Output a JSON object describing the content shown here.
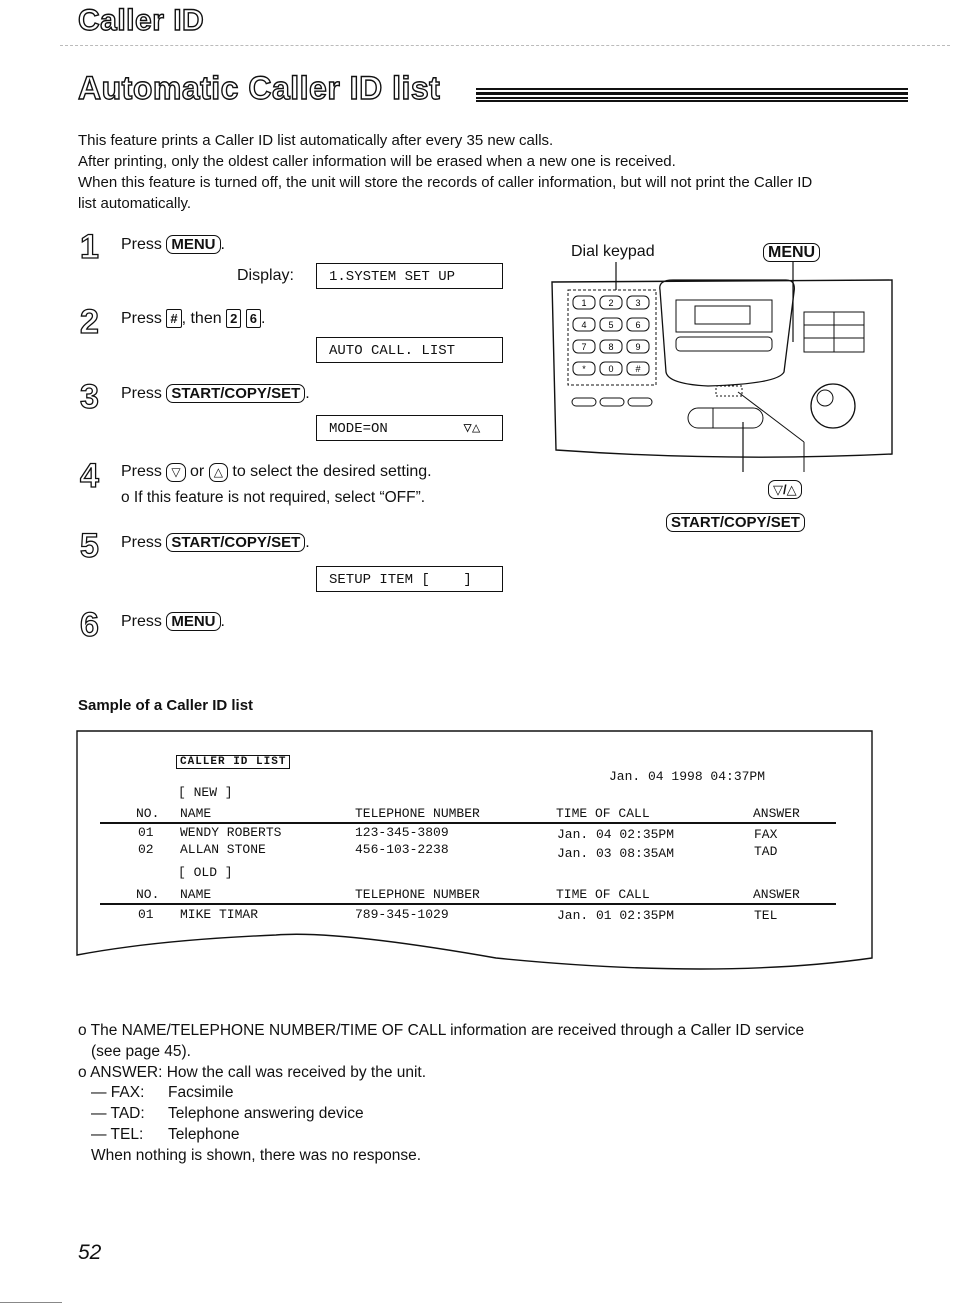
{
  "header": {
    "section_title": "Caller ID",
    "page_heading": "Automatic Caller ID list"
  },
  "intro": [
    "This feature prints a Caller ID list automatically after every 35 new calls.",
    "After printing, only the oldest caller information will be erased when a new one is received.",
    "When this feature is turned off, the unit will store the records of caller information, but will not print the Caller ID",
    "list automatically."
  ],
  "steps": [
    {
      "num": "1",
      "prefix": "Press ",
      "key1": "MENU",
      "suffix": ".",
      "display_label": "Display:",
      "display": "1.SYSTEM SET UP"
    },
    {
      "num": "2",
      "prefix": "Press ",
      "key1": "#",
      "mid": ", then ",
      "key2": "2",
      "key3": "6",
      "suffix": ".",
      "display": "AUTO CALL. LIST"
    },
    {
      "num": "3",
      "prefix": "Press ",
      "key1": "START/COPY/SET",
      "suffix": ".",
      "display": "MODE=ON         ▽△"
    },
    {
      "num": "4",
      "prefix": "Press ",
      "key1": "▽",
      "mid": " or ",
      "key2": "△",
      "suffix": " to select the desired setting.",
      "note": "o If this feature is not required, select “OFF”."
    },
    {
      "num": "5",
      "prefix": "Press ",
      "key1": "START/COPY/SET",
      "suffix": ".",
      "display": "SETUP ITEM [    ]"
    },
    {
      "num": "6",
      "prefix": "Press ",
      "key1": "MENU",
      "suffix": "."
    }
  ],
  "diagram": {
    "label_keypad": "Dial keypad",
    "label_menu": "MENU",
    "label_arrows": "▽/△",
    "label_start": "START/COPY/SET",
    "keypad_keys": [
      "1",
      "2",
      "3",
      "4",
      "5",
      "6",
      "7",
      "8",
      "9",
      "*",
      "0",
      "#"
    ]
  },
  "sample": {
    "title": "Sample of a Caller ID list",
    "list_title": "CALLER ID LIST",
    "printed_at": "Jan. 04 1998 04:37PM",
    "columns": [
      "NO.",
      "NAME",
      "TELEPHONE NUMBER",
      "TIME OF CALL",
      "ANSWER"
    ],
    "new_label": "[ NEW ]",
    "old_label": "[ OLD ]",
    "new_rows": [
      [
        "01",
        "WENDY ROBERTS",
        "123-345-3809",
        "Jan. 04 02:35PM",
        "FAX"
      ],
      [
        "02",
        "ALLAN STONE",
        "456-103-2238",
        "Jan. 03 08:35AM",
        "TAD"
      ]
    ],
    "old_rows": [
      [
        "01",
        "MIKE TIMAR",
        "789-345-1029",
        "Jan. 01 02:35PM",
        "TEL"
      ]
    ]
  },
  "notes": {
    "line1": "o The NAME/TELEPHONE NUMBER/TIME OF CALL information are received through a Caller ID service",
    "line1b": "(see page 45).",
    "line2": "o ANSWER:  How the call was received by the unit.",
    "answers": [
      {
        "code": "— FAX:",
        "desc": "Facsimile"
      },
      {
        "code": "— TAD:",
        "desc": "Telephone answering device"
      },
      {
        "code": "— TEL:",
        "desc": "Telephone"
      }
    ],
    "line_last": "When nothing is shown, there was no response."
  },
  "footer": {
    "page_number": "52"
  }
}
